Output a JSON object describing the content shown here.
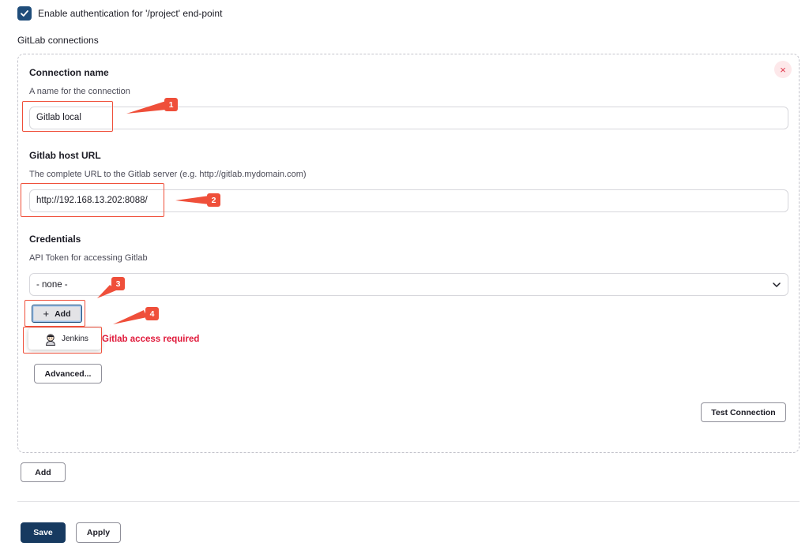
{
  "auth": {
    "checkbox_label": "Enable authentication for '/project' end-point",
    "checked": true
  },
  "section_title": "GitLab connections",
  "connection": {
    "name_label": "Connection name",
    "name_help": "A name for the connection",
    "name_value": "Gitlab local",
    "url_label": "Gitlab host URL",
    "url_help": "The complete URL to the Gitlab server (e.g. http://gitlab.mydomain.com)",
    "url_value": "http://192.168.13.202:8088/",
    "credentials_label": "Credentials",
    "credentials_help": "API Token for accessing Gitlab",
    "credentials_selected": "- none -",
    "add_credential_label": "Add",
    "dropdown_item": "Jenkins",
    "error_message": "Gitlab access required",
    "advanced_label": "Advanced...",
    "test_connection_label": "Test Connection",
    "delete_symbol": "×"
  },
  "add_connection_label": "Add",
  "footer": {
    "save_label": "Save",
    "apply_label": "Apply"
  },
  "annotations": [
    "1",
    "2",
    "3",
    "4"
  ],
  "colors": {
    "accent": "#1f4d7a",
    "annotation": "#ef4f3a",
    "error": "#e0193a",
    "save_bg": "#173a60"
  },
  "icons": {
    "checkbox": "check-icon",
    "delete": "close-icon",
    "select": "chevron-down-icon",
    "add": "plus-icon",
    "dropdown_item": "jenkins-icon"
  }
}
